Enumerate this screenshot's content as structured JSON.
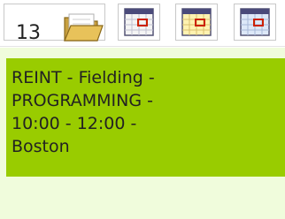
{
  "day": {
    "number": "13"
  },
  "icons": {
    "folder": "folder-open-icon",
    "views": [
      "calendar-view-icon",
      "calendar-view-yellow-icon",
      "calendar-view-blue-icon"
    ]
  },
  "event": {
    "text": "REINT - Fielding -\nPROGRAMMING -\n10:00 - 12:00 -\nBoston"
  },
  "colors": {
    "event_bg": "#99cc00",
    "cell_bg": "#f0fcdc",
    "grid_red": "#cc2200"
  }
}
